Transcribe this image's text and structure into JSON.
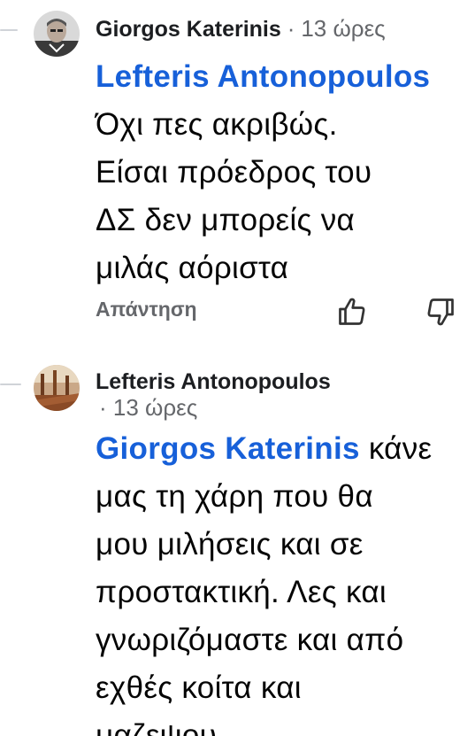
{
  "comments": [
    {
      "author": "Giorgos Katerinis",
      "time": "13 ώρες",
      "mention": "Lefteris Antonopoulos",
      "text_lines": [
        "Όχι πες ακριβώς.",
        "Είσαι πρόεδρος του",
        "ΔΣ δεν μπορείς να",
        "μιλάς αόριστα"
      ],
      "reply_label": "Απάντηση"
    },
    {
      "author": "Lefteris Antonopoulos",
      "time": "13 ώρες",
      "mention": "Giorgos Katerinis",
      "first_line_rest": "κάνε",
      "text_lines": [
        "μας τη χάρη που θα",
        "μου μιλήσεις και σε",
        "προστακτική. Λες και",
        "γνωριζόμαστε και από",
        "εχθές κοίτα και",
        "μαζεψου"
      ]
    }
  ],
  "separator": "·",
  "icons": {
    "upvote": "thumbs-up-outline",
    "downvote": "thumbs-down-outline"
  },
  "colors": {
    "mention": "#1760d9",
    "meta": "#65676b",
    "text": "#050505"
  }
}
